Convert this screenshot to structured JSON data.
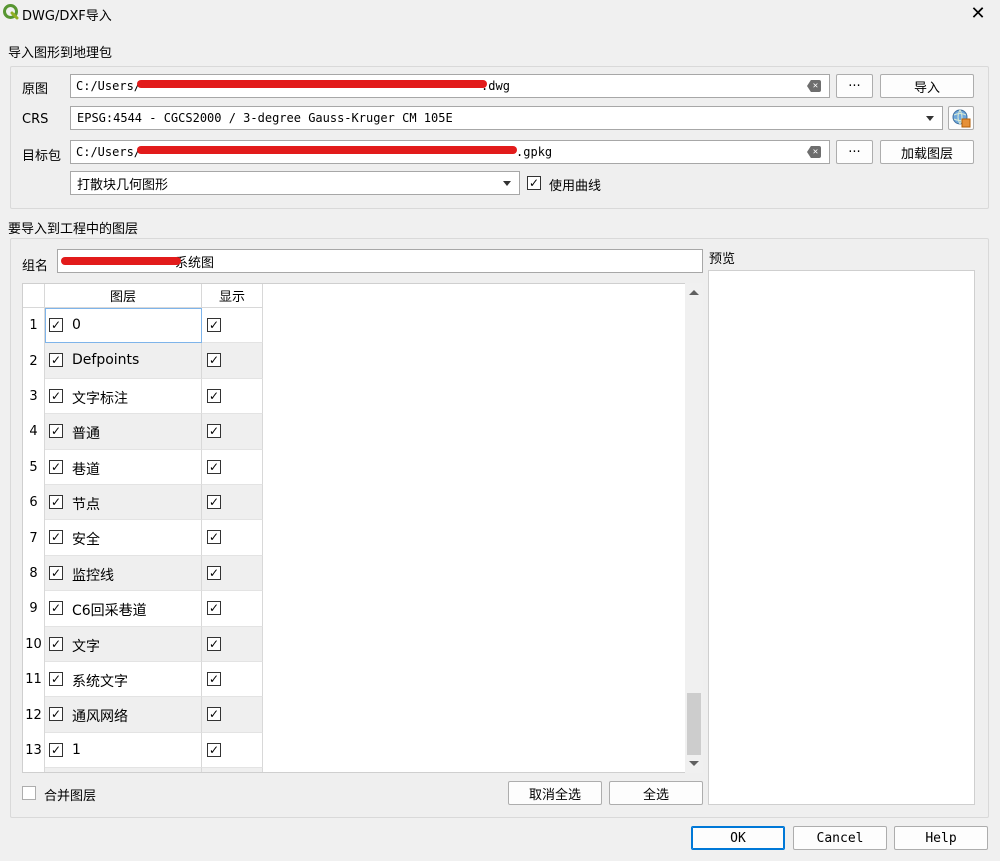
{
  "window": {
    "title": "DWG/DXF导入",
    "close_glyph": "✕"
  },
  "import_section": {
    "title": "导入图形到地理包",
    "source_label": "原图",
    "source_path_start": "C:/Users/",
    "source_path_end": ".dwg",
    "browse_glyph": "···",
    "import_button": "导入",
    "crs_label": "CRS",
    "crs_value": "EPSG:4544 - CGCS2000 / 3-degree Gauss-Kruger CM 105E",
    "target_label": "目标包",
    "target_path_start": "C:/Users/",
    "target_path_end": ".gpkg",
    "load_layers_button": "加载图层",
    "block_mode_value": "打散块几何图形",
    "use_curves_label": "使用曲线",
    "use_curves_checked": true
  },
  "layers_section": {
    "title": "要导入到工程中的图层",
    "group_name_label": "组名",
    "group_name_suffix": "系统图",
    "columns": [
      "图层",
      "显示"
    ],
    "rows": [
      {
        "num": "1",
        "name": "0"
      },
      {
        "num": "2",
        "name": "Defpoints"
      },
      {
        "num": "3",
        "name": "文字标注"
      },
      {
        "num": "4",
        "name": "普通"
      },
      {
        "num": "5",
        "name": "巷道"
      },
      {
        "num": "6",
        "name": "节点"
      },
      {
        "num": "7",
        "name": "安全"
      },
      {
        "num": "8",
        "name": "监控线"
      },
      {
        "num": "9",
        "name": "C6回采巷道"
      },
      {
        "num": "10",
        "name": "文字"
      },
      {
        "num": "11",
        "name": "系统文字"
      },
      {
        "num": "12",
        "name": "通风网络"
      },
      {
        "num": "13",
        "name": "1"
      }
    ],
    "merge_layers_label": "合并图层",
    "deselect_all_button": "取消全选",
    "select_all_button": "全选",
    "preview_label": "预览"
  },
  "footer": {
    "ok": "OK",
    "cancel": "Cancel",
    "help": "Help"
  },
  "check_glyph": "✓"
}
